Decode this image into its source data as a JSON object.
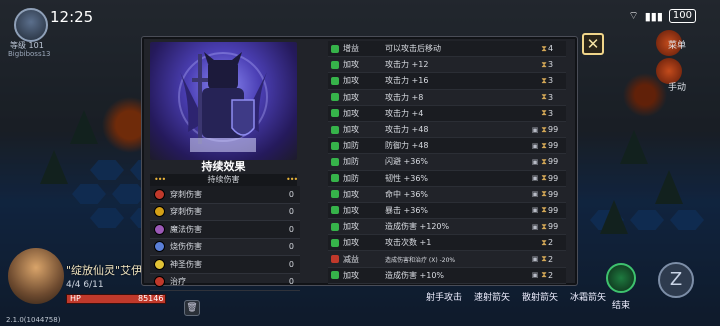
{
  "status_bar": {
    "time": "12:25",
    "battery": "100",
    "signal": "▮▮▮"
  },
  "player": {
    "level": "等级 101",
    "name": "Bigbiboss13"
  },
  "right_menu": {
    "menu_label": "菜单",
    "manual_label": "手动"
  },
  "unit": {
    "name": "\"绽放仙灵\"艾伊",
    "stats": "4/4   6/11",
    "hp_label": "HP",
    "hp_value": "85146",
    "hp_fraction": 1.0
  },
  "version": "2.1.0(1044758)",
  "bottom_actions": [
    "射手攻击",
    "速射箭矢",
    "散射箭矢",
    "冰霜箭矢"
  ],
  "end_turn_label": "结束",
  "z_button": "Z",
  "card": {
    "title": "持续效果",
    "subtitle": "持续伤害",
    "damage_types": [
      {
        "label": "穿刺伤害",
        "value": "0",
        "color": "#c0392b"
      },
      {
        "label": "穿刺伤害",
        "value": "0",
        "color": "#d4a017"
      },
      {
        "label": "魔法伤害",
        "value": "0",
        "color": "#9b59b6"
      },
      {
        "label": "烧伤伤害",
        "value": "0",
        "color": "#5b7fd6"
      },
      {
        "label": "神圣伤害",
        "value": "0",
        "color": "#e0c236"
      },
      {
        "label": "治疗",
        "value": "0",
        "color": "#c0392b"
      }
    ]
  },
  "effects": [
    {
      "icon_color": "#36b34a",
      "type": "增益",
      "desc": "可以攻击后移动",
      "lock": "",
      "turns": "4"
    },
    {
      "icon_color": "#36b34a",
      "type": "加攻",
      "desc": "攻击力 +12",
      "lock": "",
      "turns": "3"
    },
    {
      "icon_color": "#36b34a",
      "type": "加攻",
      "desc": "攻击力 +16",
      "lock": "",
      "turns": "3"
    },
    {
      "icon_color": "#36b34a",
      "type": "加攻",
      "desc": "攻击力 +8",
      "lock": "",
      "turns": "3"
    },
    {
      "icon_color": "#36b34a",
      "type": "加攻",
      "desc": "攻击力 +4",
      "lock": "",
      "turns": "3"
    },
    {
      "icon_color": "#36b34a",
      "type": "加攻",
      "desc": "攻击力 +48",
      "lock": "▣",
      "turns": "99"
    },
    {
      "icon_color": "#36b34a",
      "type": "加防",
      "desc": "防御力 +48",
      "lock": "▣",
      "turns": "99"
    },
    {
      "icon_color": "#36b34a",
      "type": "加防",
      "desc": "闪避 +36%",
      "lock": "▣",
      "turns": "99"
    },
    {
      "icon_color": "#36b34a",
      "type": "加防",
      "desc": "韧性 +36%",
      "lock": "▣",
      "turns": "99"
    },
    {
      "icon_color": "#36b34a",
      "type": "加攻",
      "desc": "命中 +36%",
      "lock": "▣",
      "turns": "99"
    },
    {
      "icon_color": "#36b34a",
      "type": "加攻",
      "desc": "暴击 +36%",
      "lock": "▣",
      "turns": "99"
    },
    {
      "icon_color": "#36b34a",
      "type": "加攻",
      "desc": "造成伤害 +120%",
      "lock": "▣",
      "turns": "99"
    },
    {
      "icon_color": "#36b34a",
      "type": "加攻",
      "desc": "攻击次数 +1",
      "lock": "",
      "turns": "2"
    },
    {
      "icon_color": "#c0392b",
      "type": "减益",
      "desc": "造成伤害和治疗 (X) -20%",
      "lock": "▣",
      "turns": "2",
      "small": true
    },
    {
      "icon_color": "#36b34a",
      "type": "加攻",
      "desc": "造成伤害 +10%",
      "lock": "▣",
      "turns": "2"
    }
  ]
}
